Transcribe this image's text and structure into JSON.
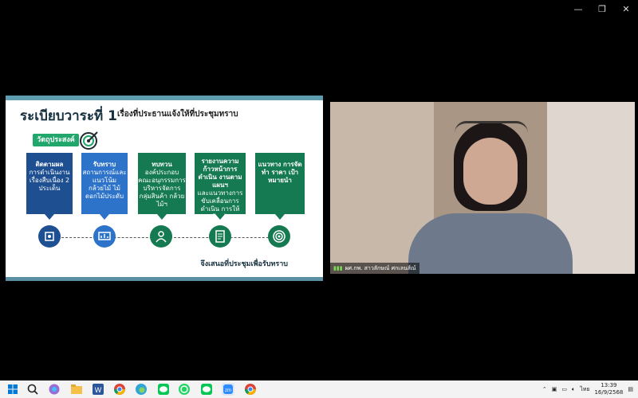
{
  "window": {
    "min_glyph": "—",
    "restore_glyph": "❐",
    "close_glyph": "✕"
  },
  "slide": {
    "title": "ระเบียบวาระที่ 1",
    "subtitle": "เรื่องที่ประธานแจ้งให้ที่ประชุมทราบ",
    "objective_label": "วัตถุประสงค์",
    "cards": [
      {
        "title": "ติดตามผล",
        "body": "การดำเนินงาน เรื่องสืบเนื่อง 2 ประเด็น"
      },
      {
        "title": "รับทราบ",
        "body": "สถานการณ์และ แนวโน้มกล้วยไม้ ไม้ดอกไม้ประดับ"
      },
      {
        "title": "ทบทวน",
        "body": "องค์ประกอบ คณะอนุกรรมการ บริหารจัดการ กลุ่มสินค้า กล้วยไม้ฯ"
      },
      {
        "title": "รายงานความ ก้าวหน้าการดำเนิน งานตามแผนฯ",
        "body": "และแนวทางการ ขับเคลื่อนการดำเนิน การให้สอดคล้องกับ แผนพัฒนาฯ"
      },
      {
        "title": "แนวทาง การจัดทำ ราคา เป้าหมายนำ",
        "body": ""
      }
    ],
    "footer": "จึงเสนอที่ประชุมเพื่อรับทราบ"
  },
  "video": {
    "participant_name": "ผศ.กพ. สาวลักษณ์ ศกเลนส์ณ์"
  },
  "taskbar": {
    "language": "ไทย",
    "time": "13:39",
    "date": "16/9/2568"
  }
}
